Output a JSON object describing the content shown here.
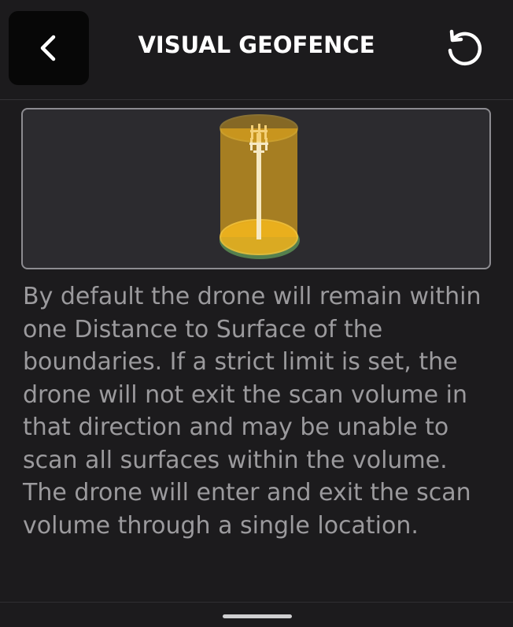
{
  "header": {
    "title": "VISUAL GEOFENCE",
    "back_icon": "chevron-left-icon",
    "reset_icon": "refresh-icon"
  },
  "preview": {
    "icon": "cell-tower-geofence-icon",
    "colors": {
      "cylinder": "#f2b21b",
      "ground": "#5a8a52",
      "tower": "#f6e9c4"
    }
  },
  "description": {
    "paragraph1": "By default the drone will remain within one Distance to Surface of the boundaries. If a strict limit is set, the drone will not exit the scan volume in that direction and may be unable to scan all surfaces within the volume.",
    "paragraph2": "The drone will enter and exit the scan volume through a single location."
  },
  "colors": {
    "background": "#1c1b1d",
    "text": "#9b9a9d",
    "title": "#ffffff"
  }
}
